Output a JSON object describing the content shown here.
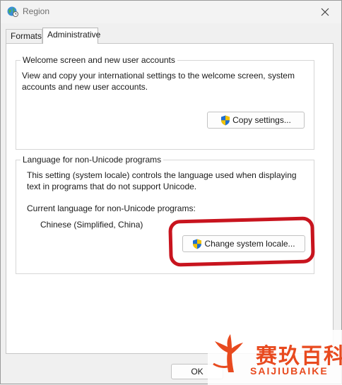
{
  "window": {
    "title": "Region"
  },
  "tabs": [
    {
      "label": "Formats",
      "selected": false
    },
    {
      "label": "Administrative",
      "selected": true
    }
  ],
  "welcome_group": {
    "title": "Welcome screen and new user accounts",
    "description_line1": "View and copy your international settings to the welcome screen, system",
    "description_line2": "accounts and new user accounts.",
    "copy_button": "Copy settings..."
  },
  "unicode_group": {
    "title": "Language for non-Unicode programs",
    "description_line1": "This setting (system locale) controls the language used when displaying",
    "description_line2": "text in programs that do not support Unicode.",
    "current_label": "Current language for non-Unicode programs:",
    "current_value": "Chinese (Simplified, China)",
    "change_button": "Change system locale..."
  },
  "footer": {
    "ok_button": "OK"
  },
  "annotation": {
    "color": "#c8141e"
  },
  "watermark": {
    "chinese_text": "赛玖百科",
    "latin_text": "SAIJIUBAIKE",
    "color": "#e84a1f"
  }
}
